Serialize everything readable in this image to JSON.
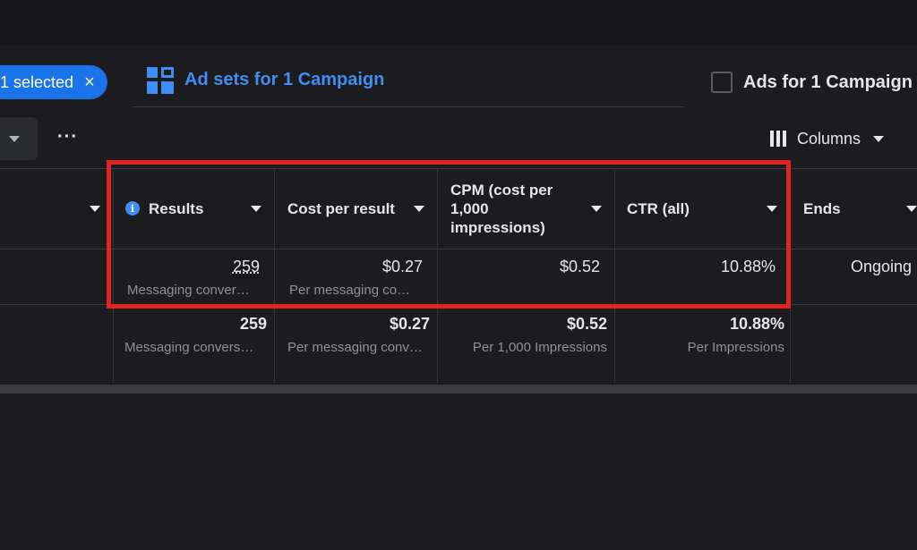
{
  "toolbar": {
    "selected_chip": "1 selected",
    "close_glyph": "×",
    "more_glyph": "···",
    "columns_label": "Columns"
  },
  "tabs": {
    "adsets_label": "Ad sets for 1 Campaign",
    "ads_label": "Ads for 1 Campaign"
  },
  "table": {
    "headers": {
      "results": "Results",
      "cost_per_result": "Cost per result",
      "cpm_line1": "CPM (cost per",
      "cpm_line2": "1,000",
      "cpm_line3": "impressions)",
      "ctr": "CTR (all)",
      "ends": "Ends"
    },
    "row": {
      "results": "259",
      "results_sub": "Messaging conver…",
      "cost_per_result": "$0.27",
      "cost_per_result_sub": "Per messaging co…",
      "cpm": "$0.52",
      "ctr": "10.88%",
      "ends": "Ongoing"
    },
    "totals": {
      "results": "259",
      "results_sub": "Messaging convers…",
      "cost_per_result": "$0.27",
      "cost_per_result_sub": "Per messaging conv…",
      "cpm": "$0.52",
      "cpm_sub": "Per 1,000 Impressions",
      "ctr": "10.88%",
      "ctr_sub": "Per Impressions"
    }
  },
  "colors": {
    "accent": "#3f8ef5",
    "chip": "#1a73e8",
    "highlight": "#e32222",
    "background": "#1c1c1e"
  },
  "icons": [
    "close-icon",
    "grid-icon",
    "checkbox-icon",
    "dropdown-caret-icon",
    "more-icon",
    "columns-icon",
    "info-icon"
  ]
}
